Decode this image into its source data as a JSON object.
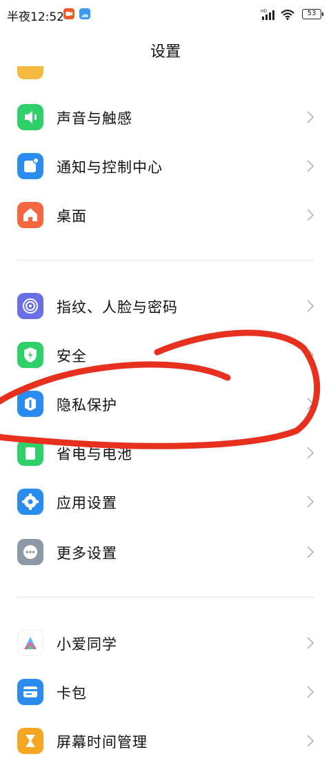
{
  "status_bar": {
    "time": "半夜12:52",
    "battery": "53"
  },
  "header": {
    "title": "设置"
  },
  "groups": [
    {
      "items": [
        {
          "label": "声音与触感",
          "icon": "sound-icon",
          "color": "#2fcf6a"
        },
        {
          "label": "通知与控制中心",
          "icon": "notification-icon",
          "color": "#2b8cf0"
        },
        {
          "label": "桌面",
          "icon": "home-icon",
          "color": "#f5673e"
        }
      ]
    },
    {
      "items": [
        {
          "label": "指纹、人脸与密码",
          "icon": "fingerprint-icon",
          "color": "#6b6fe6"
        },
        {
          "label": "安全",
          "icon": "security-shield-icon",
          "color": "#2fcf6a"
        },
        {
          "label": "隐私保护",
          "icon": "privacy-icon",
          "color": "#2b8cf0"
        },
        {
          "label": "省电与电池",
          "icon": "battery-icon",
          "color": "#2fcf6a"
        },
        {
          "label": "应用设置",
          "icon": "gear-icon",
          "color": "#2b8cf0"
        },
        {
          "label": "更多设置",
          "icon": "more-icon",
          "color": "#8e99a8"
        }
      ]
    },
    {
      "items": [
        {
          "label": "小爱同学",
          "icon": "xiaoai-icon",
          "color": "#ffffff"
        },
        {
          "label": "卡包",
          "icon": "wallet-icon",
          "color": "#2b8cf0"
        },
        {
          "label": "屏幕时间管理",
          "icon": "hourglass-icon",
          "color": "#f5a623"
        }
      ]
    }
  ],
  "annotation": {
    "color": "#e8301e"
  }
}
